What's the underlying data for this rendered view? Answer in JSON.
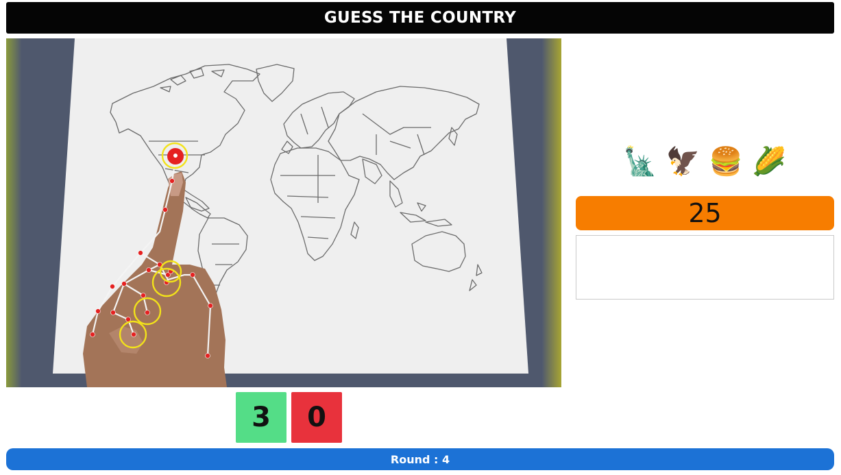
{
  "header": {
    "title": "GUESS THE COUNTRY"
  },
  "camera_feed": {
    "icon": "world-map-with-hand-tracking"
  },
  "hints": [
    {
      "emoji": "🗽",
      "icon": "statue-of-liberty-icon"
    },
    {
      "emoji": "🦅",
      "icon": "eagle-icon"
    },
    {
      "emoji": "🍔",
      "icon": "hamburger-icon"
    },
    {
      "emoji": "🌽",
      "icon": "corn-icon"
    }
  ],
  "timer": {
    "value": "25",
    "color": "#f77d00"
  },
  "answer": {
    "value": "",
    "placeholder": ""
  },
  "score": {
    "correct": "3",
    "wrong": "0",
    "correct_color": "#54dd87",
    "wrong_color": "#e8323c"
  },
  "footer": {
    "round_label": "Round : 4",
    "color": "#1c72d6"
  }
}
